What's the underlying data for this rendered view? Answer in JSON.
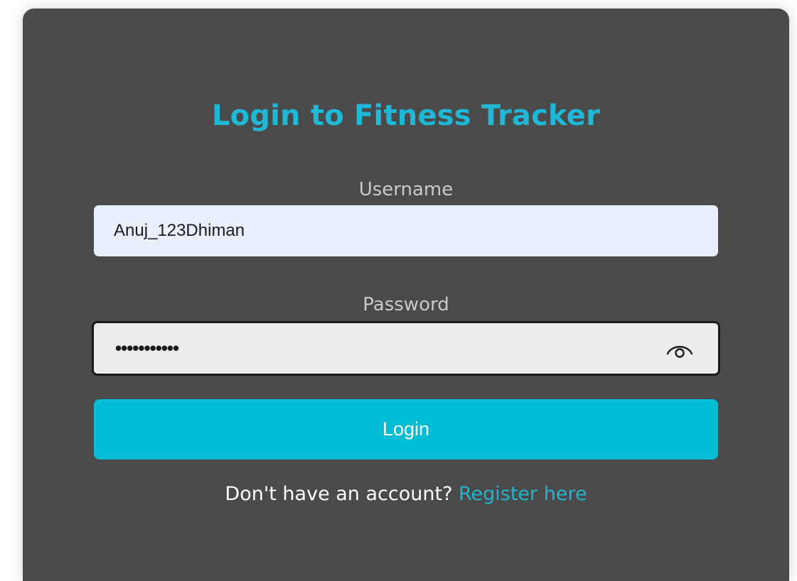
{
  "page": {
    "title": "Login to Fitness Tracker"
  },
  "form": {
    "username_label": "Username",
    "username_value": "Anuj_123Dhiman",
    "password_label": "Password",
    "password_masked": "•••••••••••",
    "login_button": "Login"
  },
  "footer": {
    "prompt": "Don't have an account?",
    "register_link": "Register here"
  },
  "icons": {
    "toggle_password": "eye-icon"
  },
  "colors": {
    "accent": "#00bcd4",
    "title": "#1fb8d6",
    "card_background": "#4a4a4a",
    "username_field_background": "#e8f0fe",
    "password_field_background": "#ececec"
  }
}
